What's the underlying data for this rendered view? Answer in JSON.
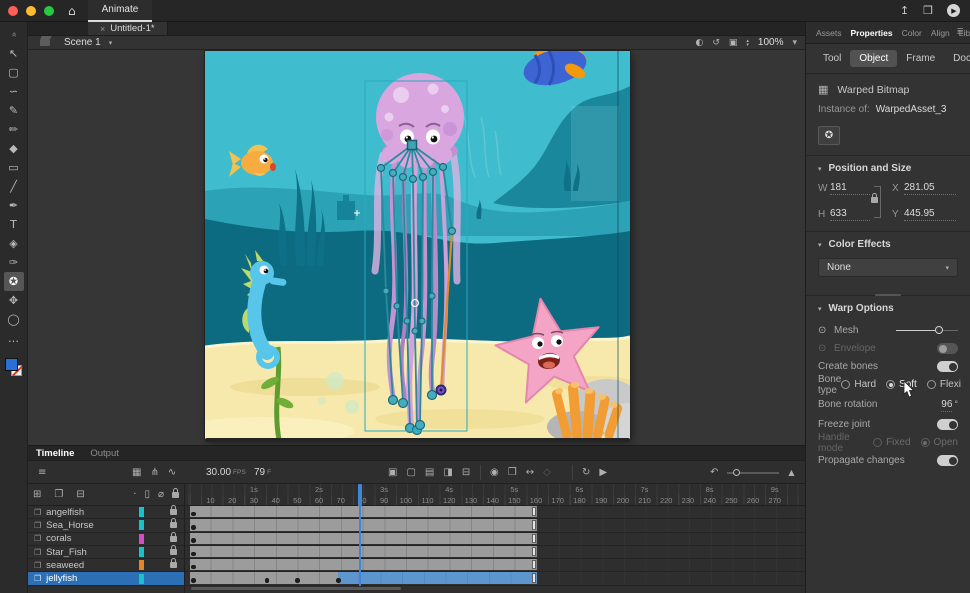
{
  "colors": {
    "accent_blue": "#3f86d6",
    "selected_row": "#2d6fb5",
    "stage_water": "#3fbccd",
    "stage_sand": "#f6e9ab",
    "bone_teal": "#2d8a9c",
    "bone_selected": "#e2892b",
    "joint_purple": "#7a52cc",
    "traffic": [
      "#ff5f57",
      "#febc2e",
      "#28c840"
    ]
  },
  "titlebar": {
    "app_tab": "Animate",
    "home_icon": "⌂",
    "share_icon": "↥",
    "workspace_icon": "❒",
    "play_icon": "▶"
  },
  "document": {
    "close": "×",
    "tab": "Untitled-1*",
    "scene": "Scene 1",
    "chevron": "▾",
    "center_icon": "◐",
    "rotate_icon": "↺",
    "clip_icon": "▣",
    "stepper_up": "▴",
    "stepper_down": "▾",
    "zoom": "100%"
  },
  "tools": [
    {
      "name": "collapse-toolbar-icon",
      "glyph": "«",
      "rotate": true
    },
    {
      "name": "selection-tool",
      "glyph": "↖"
    },
    {
      "name": "free-transform-tool",
      "glyph": "▢"
    },
    {
      "name": "lasso-tool",
      "glyph": "∽"
    },
    {
      "name": "fluid-brush-tool",
      "glyph": "✎"
    },
    {
      "name": "classic-brush-tool",
      "glyph": "✏"
    },
    {
      "name": "eraser-tool",
      "glyph": "◆"
    },
    {
      "name": "rectangle-tool",
      "glyph": "▭"
    },
    {
      "name": "line-tool",
      "glyph": "╱"
    },
    {
      "name": "pen-tool",
      "glyph": "✒"
    },
    {
      "name": "text-tool",
      "glyph": "T"
    },
    {
      "name": "paint-bucket-tool",
      "glyph": "◈"
    },
    {
      "name": "eyedropper-tool",
      "glyph": "✑"
    },
    {
      "name": "asset-warp-tool",
      "glyph": "✪",
      "selected": true
    },
    {
      "name": "hand-tool",
      "glyph": "✥"
    },
    {
      "name": "zoom-tool",
      "glyph": "◯"
    },
    {
      "name": "more-tools",
      "glyph": "…"
    }
  ],
  "swatches": {
    "fill": "#2a6fd6"
  },
  "panel": {
    "tabs": [
      {
        "label": "Assets",
        "active": false
      },
      {
        "label": "Properties",
        "active": true
      },
      {
        "label": "Color",
        "active": false
      },
      {
        "label": "Align",
        "active": false
      },
      {
        "label": "Library",
        "active": false
      }
    ],
    "menu_icon": "≣",
    "subtabs": [
      {
        "label": "Tool",
        "active": false
      },
      {
        "label": "Object",
        "active": true
      },
      {
        "label": "Frame",
        "active": false
      },
      {
        "label": "Doc",
        "active": false
      }
    ],
    "object_icon": "▦",
    "object_type": "Warped Bitmap",
    "instance_label": "Instance of:",
    "instance_value": "WarpedAsset_3",
    "warp_button_icon": "✪",
    "position": {
      "title": "Position and Size",
      "w_label": "W",
      "w_value": "181",
      "h_label": "H",
      "h_value": "633",
      "x_label": "X",
      "x_value": "281.05",
      "y_label": "Y",
      "y_value": "445.95"
    },
    "color_effects": {
      "title": "Color Effects",
      "value": "None",
      "chevron": "▾"
    },
    "warp": {
      "title": "Warp Options",
      "mesh_label": "Mesh",
      "eye_icon": "⊙",
      "envelope_label": "Envelope",
      "create_bones_label": "Create bones",
      "bone_type_label": "Bone type",
      "bone_options": [
        "Hard",
        "Soft",
        "Flexi"
      ],
      "bone_selected": "Soft",
      "bone_rotation_label": "Bone rotation",
      "bone_rotation_value": "96",
      "degree": "°",
      "freeze_label": "Freeze joint",
      "handle_label": "Handle mode",
      "handle_options": [
        "Fixed",
        "Open"
      ],
      "handle_selected": "Open",
      "propagate_label": "Propagate changes"
    }
  },
  "timeline": {
    "tabs": [
      {
        "label": "Timeline",
        "active": true
      },
      {
        "label": "Output",
        "active": false
      }
    ],
    "layers_icon": {
      "name": "layers-icon",
      "glyph": "≡"
    },
    "view_icons": [
      {
        "name": "camera-icon",
        "glyph": "▦"
      },
      {
        "name": "layer-parenting-icon",
        "glyph": "⋔"
      },
      {
        "name": "graph-editor-icon",
        "glyph": "∿"
      }
    ],
    "fps_value": "30.00",
    "fps_unit": "FPS",
    "frame_value": "79",
    "frame_unit": "F",
    "frame_icons": [
      {
        "name": "insert-keyframe-icon",
        "glyph": "▣"
      },
      {
        "name": "insert-blank-keyframe-icon",
        "glyph": "▢"
      },
      {
        "name": "insert-frame-icon",
        "glyph": "▤"
      },
      {
        "name": "auto-keyframe-icon",
        "glyph": "◨"
      },
      {
        "name": "delete-frame-icon",
        "glyph": "⊟"
      }
    ],
    "onion_icons": [
      {
        "name": "onion-skin-icon",
        "glyph": "◉"
      },
      {
        "name": "onion-skin-outlines-icon",
        "glyph": "❐"
      },
      {
        "name": "edit-multiple-frames-icon",
        "glyph": "↔"
      },
      {
        "name": "modify-markers-icon",
        "glyph": "◇",
        "disabled": true
      }
    ],
    "play_icons": [
      {
        "name": "loop-icon",
        "glyph": "↻"
      },
      {
        "name": "play-icon",
        "glyph": "▶"
      }
    ],
    "right_icons": [
      {
        "name": "center-playhead-icon",
        "glyph": "↶"
      },
      {
        "name": "resize-view-icon",
        "glyph": "▲"
      }
    ],
    "header_icons": [
      {
        "name": "new-layer-icon",
        "glyph": "⊞"
      },
      {
        "name": "new-folder-icon",
        "glyph": "❐"
      },
      {
        "name": "delete-layer-icon",
        "glyph": "⊟"
      }
    ],
    "header_col_icons": [
      {
        "name": "highlight-column-icon",
        "glyph": "·"
      },
      {
        "name": "outline-column-icon",
        "glyph": "▯"
      },
      {
        "name": "hide-column-icon",
        "glyph": "⌀"
      },
      {
        "name": "lock-column-icon",
        "glyph": "lock"
      }
    ],
    "layer_icon_glyph": "❐",
    "ruler_seconds": [
      "1s",
      "2s",
      "3s",
      "4s",
      "5s",
      "6s",
      "7s",
      "8s",
      "9s"
    ],
    "ruler_frames": [
      "10",
      "20",
      "30",
      "40",
      "50",
      "60",
      "70",
      "80",
      "90",
      "100",
      "110",
      "120",
      "130",
      "140",
      "150",
      "160",
      "170",
      "180",
      "190",
      "200",
      "210",
      "220",
      "230",
      "240",
      "250",
      "260",
      "270"
    ],
    "playhead_frame": 79,
    "span_start": 1,
    "span_end": 160,
    "layers": [
      {
        "name": "angelfish",
        "color": "#19c2cb",
        "locked": true,
        "selected": false,
        "keyframes": [
          1
        ]
      },
      {
        "name": "Sea_Horse",
        "color": "#19c2cb",
        "locked": true,
        "selected": false,
        "keyframes": [
          1
        ]
      },
      {
        "name": "corals",
        "color": "#d24fc8",
        "locked": true,
        "selected": false,
        "keyframes": [
          1
        ]
      },
      {
        "name": "Star_Fish",
        "color": "#19c2cb",
        "locked": true,
        "selected": false,
        "keyframes": [
          1
        ]
      },
      {
        "name": "seaweed",
        "color": "#e2862a",
        "locked": true,
        "selected": false,
        "keyframes": [
          1
        ]
      },
      {
        "name": "jellyfish",
        "color": "#19c2cb",
        "locked": false,
        "selected": true,
        "keyframes": [
          1,
          35,
          49,
          68
        ],
        "blue_from": 69
      }
    ]
  }
}
